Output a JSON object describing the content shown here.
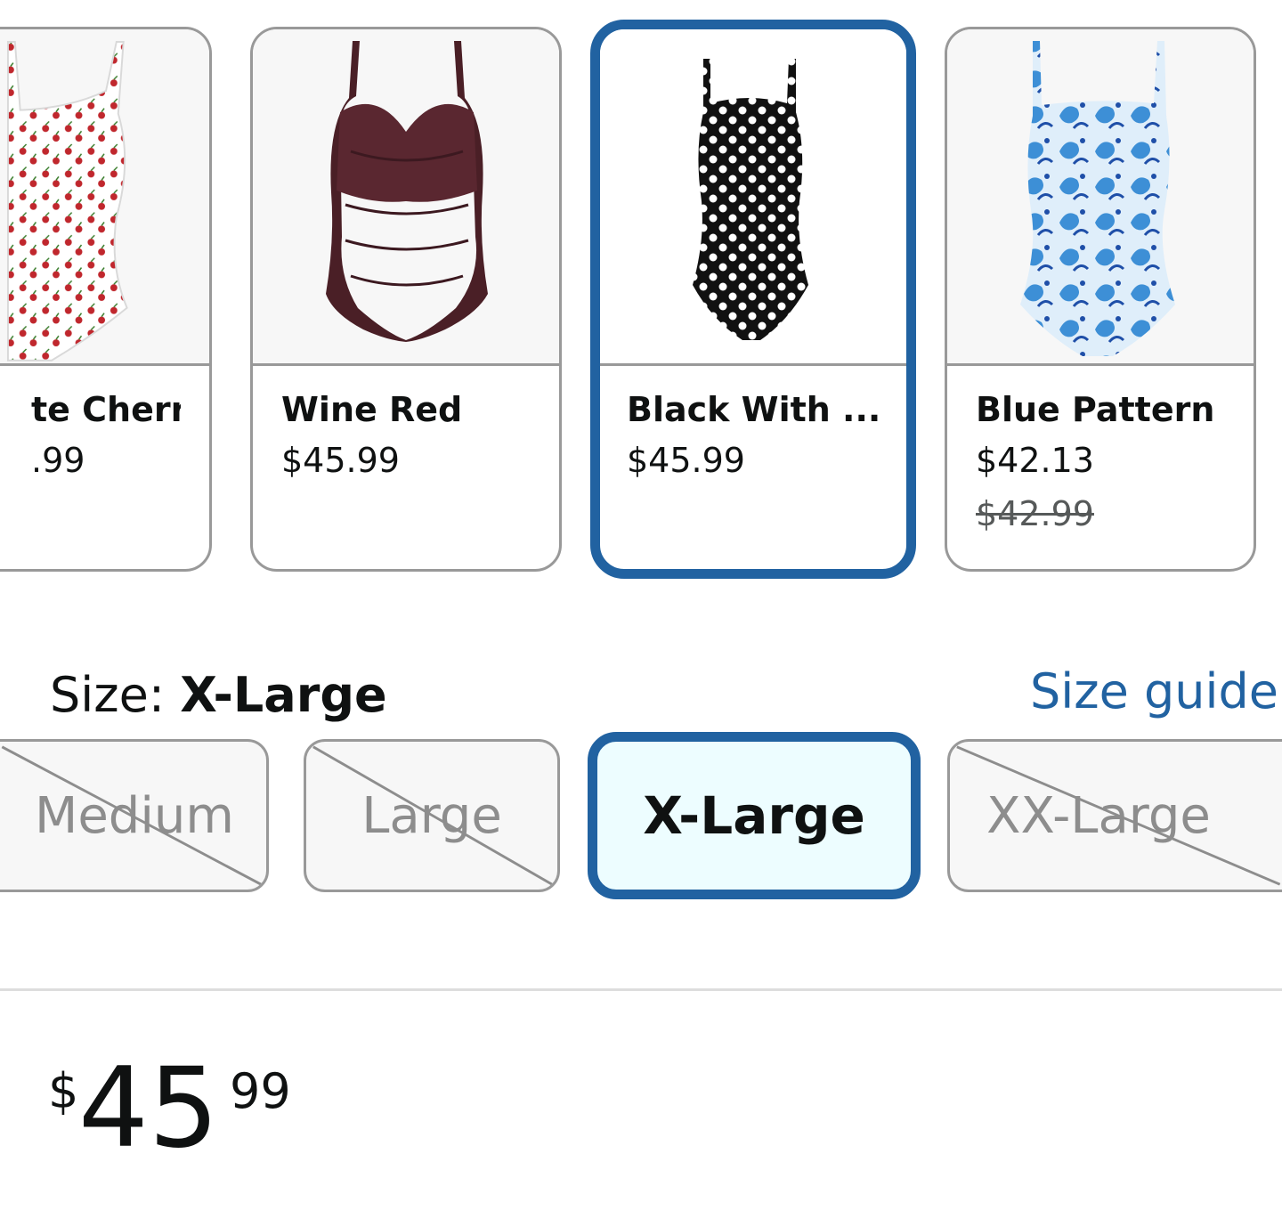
{
  "colors": {
    "accent": "#2162a1",
    "border": "#999999",
    "selected_size_bg": "#edfdff",
    "unavailable_text": "#8d8d8d"
  },
  "swatches": [
    {
      "name": "te Cherry",
      "price": ".99",
      "old_price": "",
      "image": "cherry-print-swimsuit",
      "selected": false
    },
    {
      "name": "Wine Red",
      "price": "$45.99",
      "old_price": "",
      "image": "wine-red-swimsuit",
      "selected": false
    },
    {
      "name": "Black With ...",
      "price": "$45.99",
      "old_price": "",
      "image": "black-polka-dot-swimsuit",
      "selected": true
    },
    {
      "name": "Blue Pattern",
      "price": "$42.13",
      "old_price": "$42.99",
      "image": "blue-paisley-swimsuit",
      "selected": false
    }
  ],
  "size": {
    "label": "Size:",
    "value": "X-Large",
    "guide_link": "Size guide",
    "options": [
      {
        "label": "Medium",
        "available": false,
        "selected": false
      },
      {
        "label": "Large",
        "available": false,
        "selected": false
      },
      {
        "label": "X-Large",
        "available": true,
        "selected": true
      },
      {
        "label": "XX-Large",
        "available": false,
        "selected": false
      }
    ]
  },
  "price": {
    "symbol": "$",
    "whole": "45",
    "fraction": "99"
  }
}
